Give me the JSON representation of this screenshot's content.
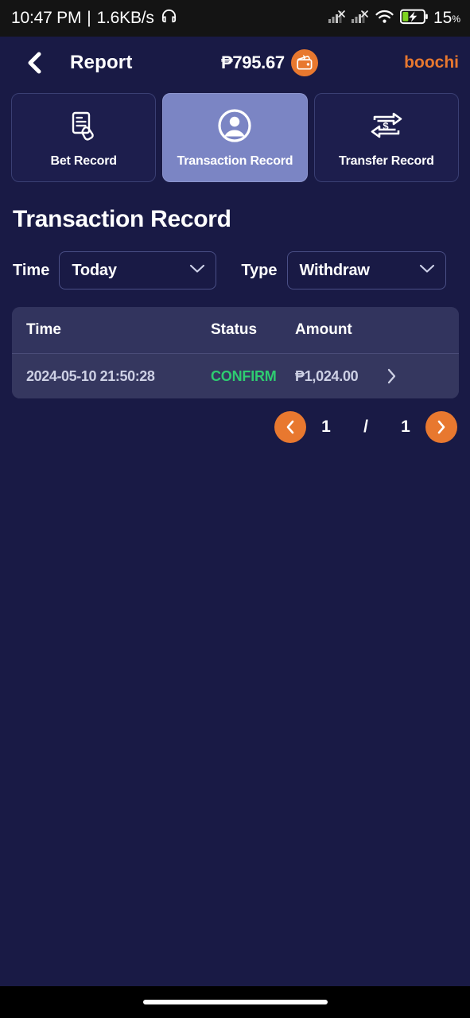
{
  "status_bar": {
    "time": "10:47 PM",
    "separator": "|",
    "network_speed": "1.6KB/s",
    "headset_icon": "headset-icon",
    "signal_icons": [
      "signal-no-sim-icon",
      "signal-no-sim-icon"
    ],
    "wifi_icon": "wifi-icon",
    "battery_icon": "battery-charging-icon",
    "battery_percent": "15",
    "battery_percent_symbol": "%"
  },
  "header": {
    "back_icon": "chevron-left-icon",
    "title": "Report",
    "balance": "₱795.67",
    "wallet_icon": "wallet-coin-icon",
    "username": "boochi"
  },
  "tabs": [
    {
      "id": "bet-record",
      "label": "Bet Record",
      "icon": "document-hand-icon",
      "active": false
    },
    {
      "id": "transaction-record",
      "label": "Transaction Record",
      "icon": "user-circle-icon",
      "active": true
    },
    {
      "id": "transfer-record",
      "label": "Transfer Record",
      "icon": "transfer-money-icon",
      "active": false
    }
  ],
  "page": {
    "title": "Transaction Record"
  },
  "filters": {
    "time": {
      "label": "Time",
      "value": "Today",
      "chevron_icon": "chevron-down-icon"
    },
    "type": {
      "label": "Type",
      "value": "Withdraw",
      "chevron_icon": "chevron-down-icon"
    }
  },
  "table": {
    "columns": [
      "Time",
      "Status",
      "Amount"
    ],
    "rows": [
      {
        "time": "2024-05-10 21:50:28",
        "status": "CONFIRM",
        "amount": "₱1,024.00",
        "chevron_icon": "chevron-right-icon"
      }
    ]
  },
  "pagination": {
    "prev_icon": "chevron-left-icon",
    "current_page": "1",
    "separator": "/",
    "total_pages": "1",
    "next_icon": "chevron-right-icon"
  },
  "colors": {
    "background": "#191a45",
    "accent_orange": "#e8782f",
    "active_tab": "#7b85c4",
    "table_header": "#32345e",
    "table_row": "#35375f",
    "status_confirm_green": "#2ecc71",
    "status_bar_bg": "#141414"
  }
}
